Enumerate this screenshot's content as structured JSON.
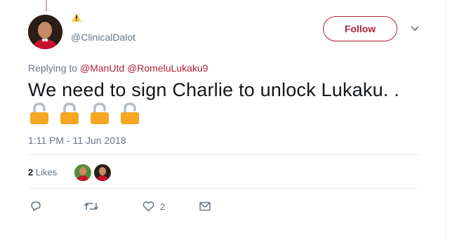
{
  "author": {
    "handle": "@ClinicalDalot",
    "name_icon": "warning-icon"
  },
  "follow_button": {
    "label": "Follow"
  },
  "menu_icon": "chevron-down-icon",
  "replying": {
    "prefix": "Replying to",
    "mentions": [
      "@ManUtd",
      "@RomeluLukaku9"
    ]
  },
  "tweet": {
    "text": "We need to sign Charlie to unlock Lukaku. .",
    "emoji": [
      "lock-icon",
      "lock-icon",
      "lock-icon",
      "lock-icon"
    ]
  },
  "timestamp": "1:11 PM - 11 Jun 2018",
  "stats": {
    "likes_count": "2",
    "likes_label": "Likes"
  },
  "actions": {
    "reply_icon": "reply-icon",
    "retweet_icon": "retweet-icon",
    "like_icon": "heart-icon",
    "like_count": "2",
    "dm_icon": "mail-icon"
  },
  "colors": {
    "accent": "#b0223a",
    "muted": "#657786",
    "lock": "#f5a623"
  }
}
